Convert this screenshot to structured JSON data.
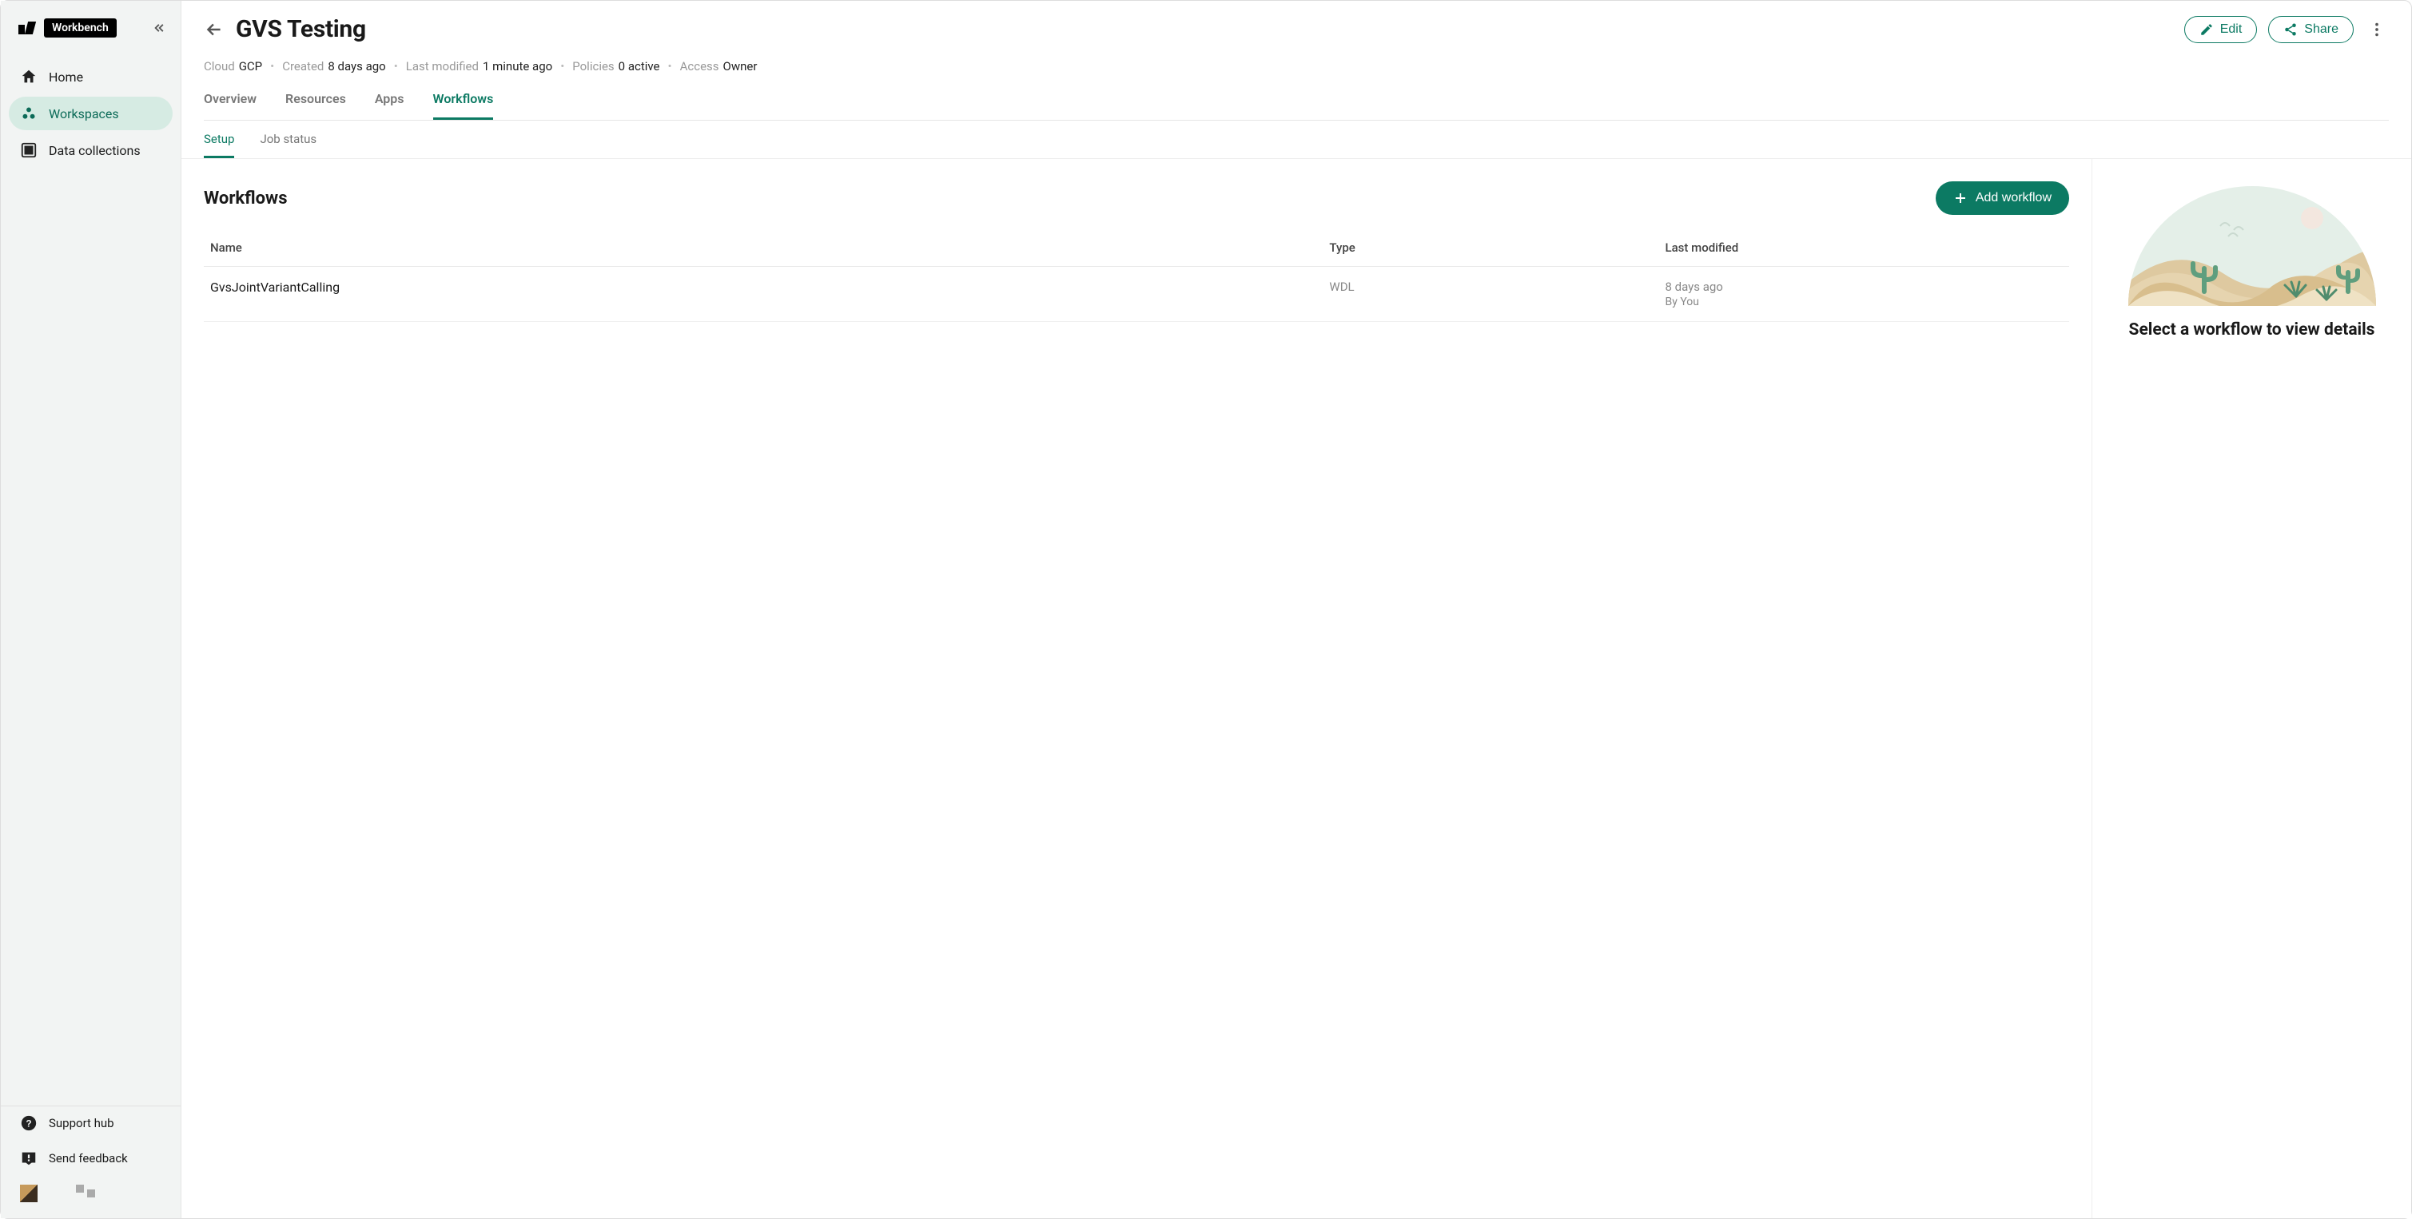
{
  "brand": "Workbench",
  "sidebar": {
    "items": [
      {
        "label": "Home"
      },
      {
        "label": "Workspaces"
      },
      {
        "label": "Data collections"
      }
    ],
    "footer": [
      {
        "label": "Support hub"
      },
      {
        "label": "Send feedback"
      }
    ]
  },
  "page": {
    "title": "GVS Testing",
    "actions": {
      "edit": "Edit",
      "share": "Share"
    },
    "meta": {
      "cloud_label": "Cloud",
      "cloud_value": "GCP",
      "created_label": "Created",
      "created_value": "8 days ago",
      "modified_label": "Last modified",
      "modified_value": "1 minute ago",
      "policies_label": "Policies",
      "policies_value": "0 active",
      "access_label": "Access",
      "access_value": "Owner"
    }
  },
  "tabs": [
    "Overview",
    "Resources",
    "Apps",
    "Workflows"
  ],
  "subtabs": [
    "Setup",
    "Job status"
  ],
  "workflows": {
    "heading": "Workflows",
    "add_label": "Add workflow",
    "columns": {
      "name": "Name",
      "type": "Type",
      "modified": "Last modified"
    },
    "rows": [
      {
        "name": "GvsJointVariantCalling",
        "type": "WDL",
        "modified": "8 days ago",
        "by": "By You"
      }
    ]
  },
  "detail_placeholder": "Select a workflow to view details"
}
